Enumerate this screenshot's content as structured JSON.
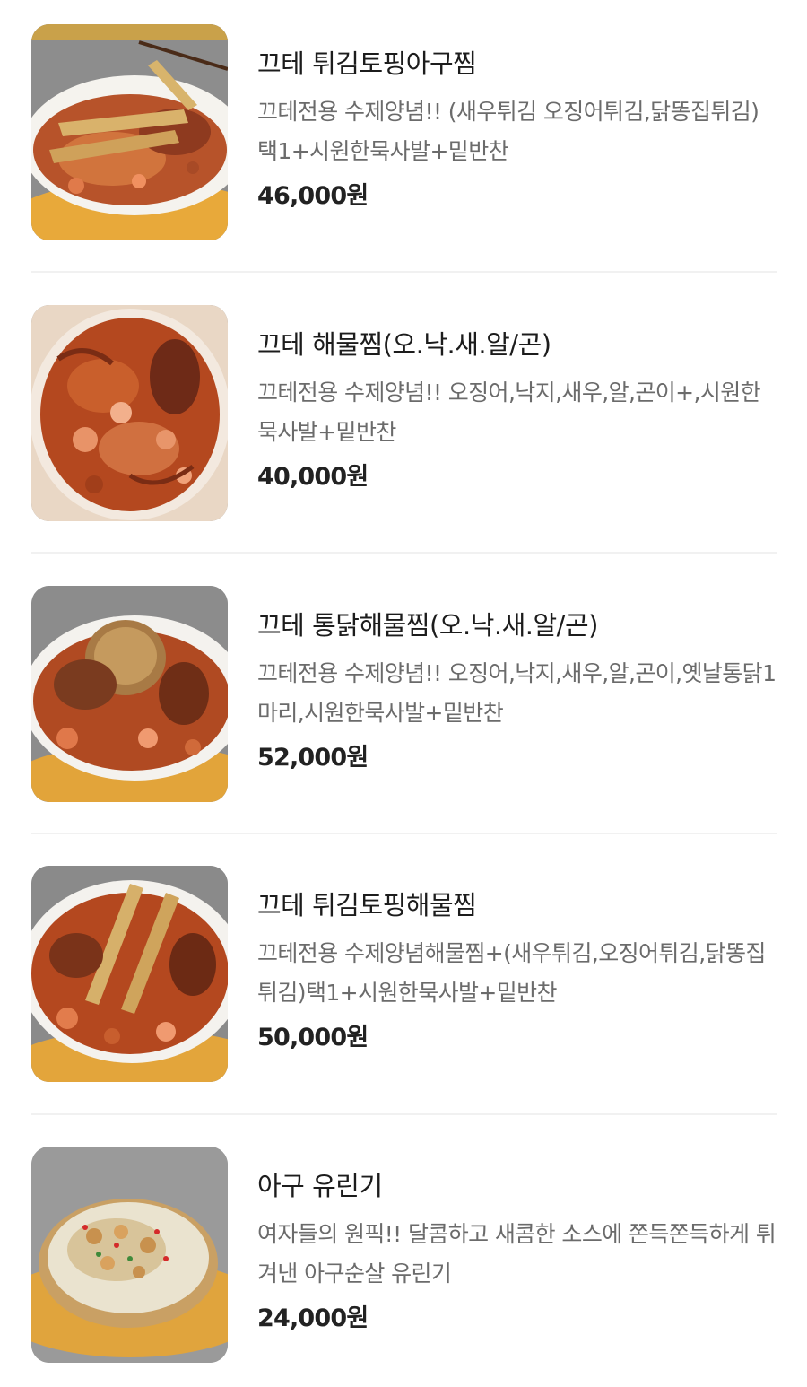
{
  "menu": {
    "items": [
      {
        "name": "끄테 튀김토핑아구찜",
        "description": "끄테전용 수제양념!! (새우튀김 오징어튀김,닭똥집튀김)택1+시원한묵사발+밑반찬",
        "price": "46,000원"
      },
      {
        "name": "끄테 해물찜(오.낙.새.알/곤)",
        "description": "끄테전용 수제양념!! 오징어,낙지,새우,알,곤이+,시원한묵사발+밑반찬",
        "price": "40,000원"
      },
      {
        "name": "끄테 통닭해물찜(오.낙.새.알/곤)",
        "description": "끄테전용 수제양념!! 오징어,낙지,새우,알,곤이,옛날통닭1마리,시원한묵사발+밑반찬",
        "price": "52,000원"
      },
      {
        "name": "끄테 튀김토핑해물찜",
        "description": "끄테전용 수제양념해물찜+(새우튀김,오징어튀김,닭똥집튀김)택1+시원한묵사발+밑반찬",
        "price": "50,000원"
      },
      {
        "name": "아구 유린기",
        "description": "여자들의 원픽!! 달콤하고 새콤한 소스에 쫀득쫀득하게 튀겨낸 아구순살 유린기",
        "price": "24,000원"
      }
    ]
  }
}
